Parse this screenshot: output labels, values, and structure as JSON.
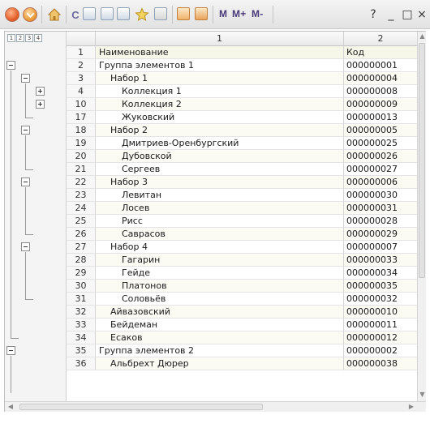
{
  "toolbar": {
    "m_label": "M",
    "mplus_label": "M+",
    "mminus_label": "M-",
    "help_label": "?",
    "minimize_label": "_",
    "maximize_label": "□",
    "close_label": "×"
  },
  "grid": {
    "level_buttons": [
      "1",
      "2",
      "3",
      "4"
    ],
    "columns": [
      "1",
      "2"
    ],
    "rows": [
      {
        "num": "1",
        "name": "Наименование",
        "code": "Код"
      },
      {
        "num": "2",
        "name": "Группа элементов 1",
        "code": "000000001"
      },
      {
        "num": "3",
        "name": "Набор 1",
        "code": "000000004"
      },
      {
        "num": "4",
        "name": "Коллекция 1",
        "code": "000000008"
      },
      {
        "num": "10",
        "name": "Коллекция 2",
        "code": "000000009"
      },
      {
        "num": "17",
        "name": "Жуковский",
        "code": "000000013"
      },
      {
        "num": "18",
        "name": "Набор 2",
        "code": "000000005"
      },
      {
        "num": "19",
        "name": "Дмитриев-Оренбургский",
        "code": "000000025"
      },
      {
        "num": "20",
        "name": "Дубовской",
        "code": "000000026"
      },
      {
        "num": "21",
        "name": "Сергеев",
        "code": "000000027"
      },
      {
        "num": "22",
        "name": "Набор 3",
        "code": "000000006"
      },
      {
        "num": "23",
        "name": "Левитан",
        "code": "000000030"
      },
      {
        "num": "24",
        "name": "Лосев",
        "code": "000000031"
      },
      {
        "num": "25",
        "name": "Рисс",
        "code": "000000028"
      },
      {
        "num": "26",
        "name": "Саврасов",
        "code": "000000029"
      },
      {
        "num": "27",
        "name": "Набор 4",
        "code": "000000007"
      },
      {
        "num": "28",
        "name": "Гагарин",
        "code": "000000033"
      },
      {
        "num": "29",
        "name": "Гейде",
        "code": "000000034"
      },
      {
        "num": "30",
        "name": "Платонов",
        "code": "000000035"
      },
      {
        "num": "31",
        "name": "Соловьёв",
        "code": "000000032"
      },
      {
        "num": "32",
        "name": "Айвазовский",
        "code": "000000010"
      },
      {
        "num": "33",
        "name": "Бейдеман",
        "code": "000000011"
      },
      {
        "num": "34",
        "name": "Есаков",
        "code": "000000012"
      },
      {
        "num": "35",
        "name": "Группа элементов 2",
        "code": "000000002"
      },
      {
        "num": "36",
        "name": "Альбрехт Дюрер",
        "code": "000000038"
      }
    ]
  },
  "colors": {
    "toolbar_text": "#4a3a78",
    "header_row_bg": "#f6f6e9",
    "tree_panel_bg": "#f4f4f4"
  }
}
